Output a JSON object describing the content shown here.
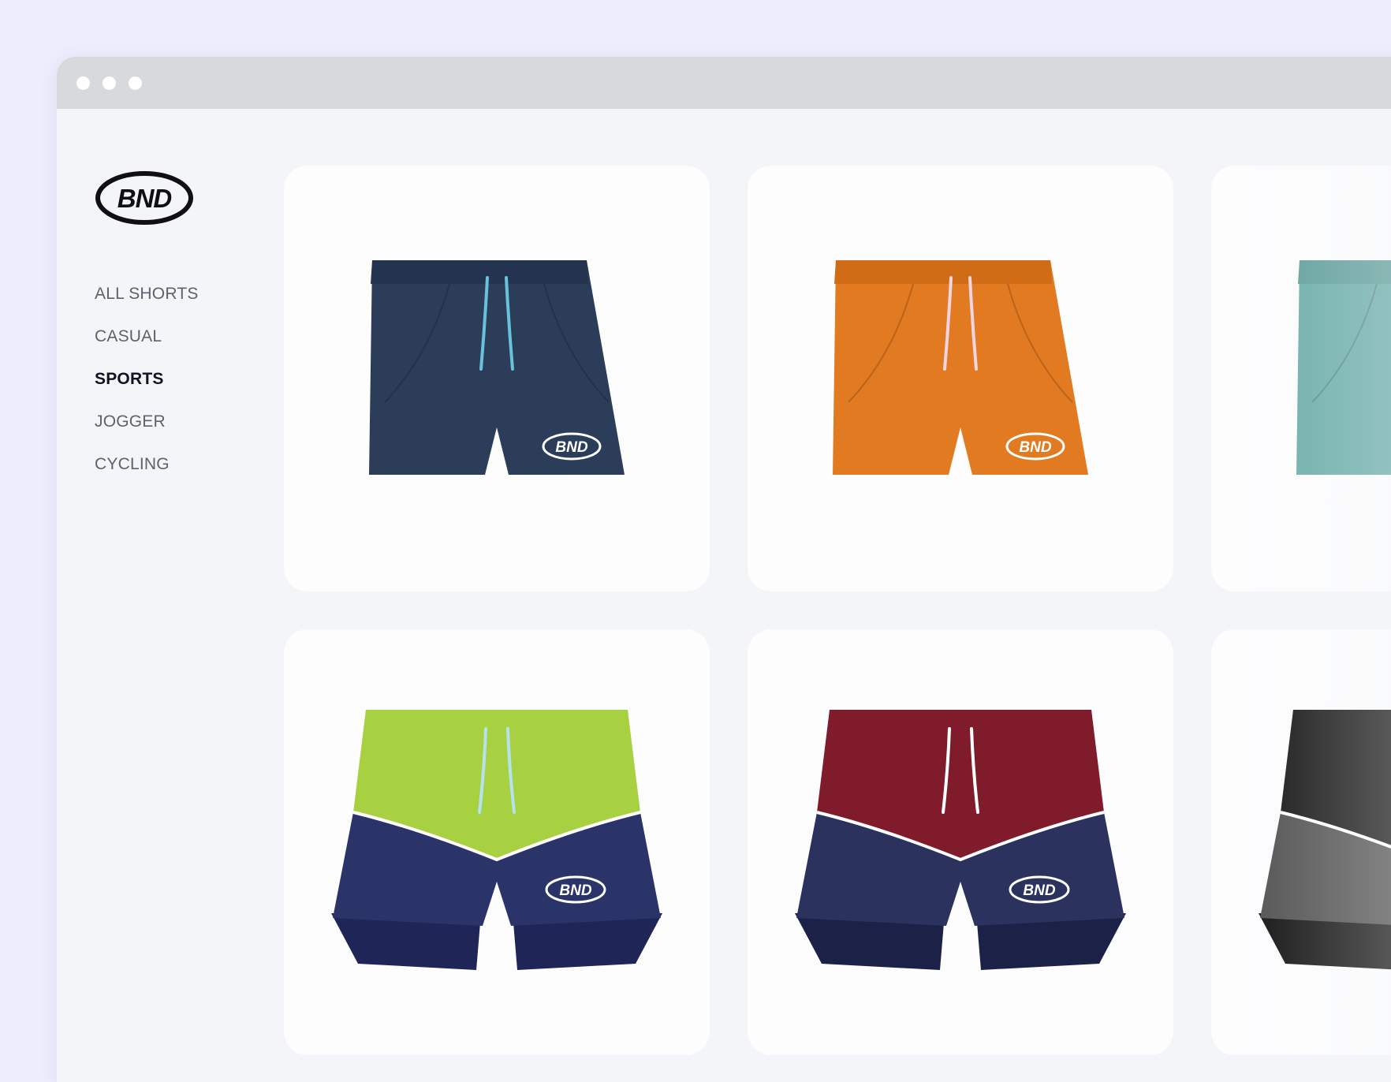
{
  "brand": {
    "logo_text": "BND"
  },
  "nav": {
    "items": [
      {
        "label": "ALL SHORTS",
        "active": false
      },
      {
        "label": "CASUAL",
        "active": false
      },
      {
        "label": "SPORTS",
        "active": true
      },
      {
        "label": "JOGGER",
        "active": false
      },
      {
        "label": "CYCLING",
        "active": false
      }
    ]
  },
  "products": [
    {
      "style": "plain",
      "colors": {
        "body": "#2c3d5a",
        "waistband": "#243350",
        "drawstring": "#67c2dc"
      },
      "logo_text": "BND"
    },
    {
      "style": "plain",
      "colors": {
        "body": "#e27a22",
        "waistband": "#d06b16",
        "drawstring": "#f1d5e2"
      },
      "logo_text": "BND"
    },
    {
      "style": "plain",
      "colors": {
        "body": "#66aba6",
        "waistband": "#5b9c97",
        "drawstring": "#ffffff"
      },
      "logo_text": ""
    },
    {
      "style": "colorblock",
      "colors": {
        "top": "#a8d142",
        "bottom": "#2b3469",
        "liner": "#1f2657",
        "drawstring": "#b5e2ef"
      },
      "logo_text": "BND"
    },
    {
      "style": "colorblock",
      "colors": {
        "top": "#7f1b2b",
        "bottom": "#2a325d",
        "liner": "#1c2148",
        "drawstring": "#ffffff"
      },
      "logo_text": "BND"
    },
    {
      "style": "colorblock",
      "colors": {
        "top": "#131313",
        "bottom": "#4f4f4f",
        "liner": "#101010",
        "drawstring": "#ffffff"
      },
      "logo_text": ""
    }
  ]
}
